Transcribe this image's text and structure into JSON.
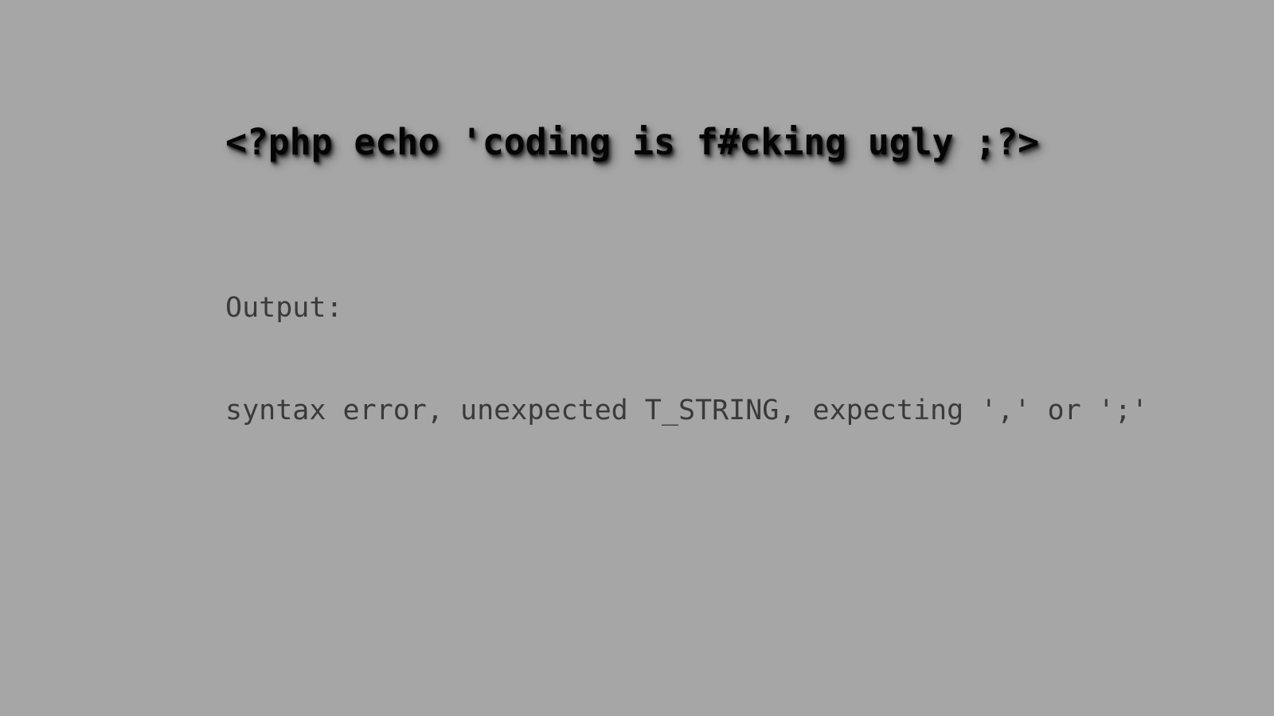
{
  "slide": {
    "background_color": "#a6a6a6",
    "headline": {
      "text": "<?php echo 'coding is f#cking ugly ;?>",
      "color": "#050505",
      "shadow_color": "#000000"
    },
    "output": {
      "label": "Output:",
      "error_line": "syntax error, unexpected T_STRING, expecting ',' or ';'",
      "color": "#3a3a3a"
    }
  }
}
